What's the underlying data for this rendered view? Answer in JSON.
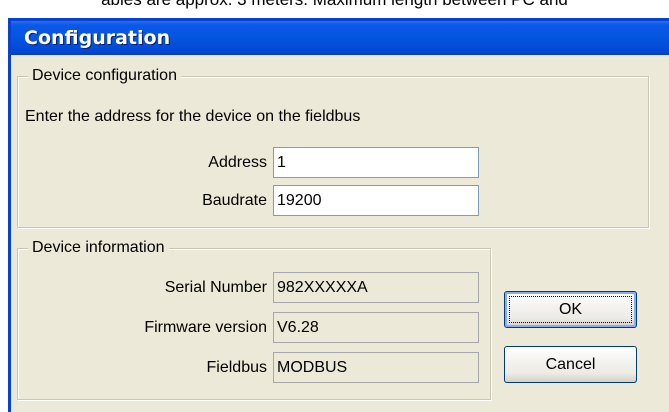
{
  "background": {
    "doc_text": "ables are approx. 3 meters. Maximum length between PC and"
  },
  "dialog": {
    "title": "Configuration",
    "device_configuration": {
      "legend": "Device configuration",
      "instruction": "Enter the address for the device on the fieldbus",
      "address_label": "Address",
      "address_value": "1",
      "baudrate_label": "Baudrate",
      "baudrate_value": "19200"
    },
    "device_information": {
      "legend": "Device information",
      "serial_label": "Serial Number",
      "serial_value": "982XXXXXA",
      "firmware_label": "Firmware version",
      "firmware_value": "V6.28",
      "fieldbus_label": "Fieldbus",
      "fieldbus_value": "MODBUS"
    },
    "buttons": {
      "ok": "OK",
      "cancel": "Cancel"
    }
  },
  "colors": {
    "title_bar": "#0455df",
    "dialog_face": "#ece9d8",
    "default_button_focus": "#89adf5"
  }
}
